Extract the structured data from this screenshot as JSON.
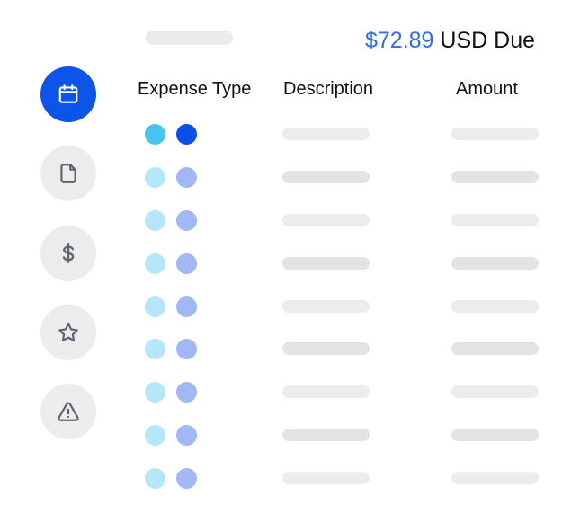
{
  "header": {
    "amount_due": "$72.89",
    "due_suffix": "USD Due"
  },
  "sidebar": {
    "items": [
      {
        "name": "calendar",
        "icon": "calendar-icon",
        "active": true
      },
      {
        "name": "document",
        "icon": "document-icon",
        "active": false
      },
      {
        "name": "dollar",
        "icon": "dollar-icon",
        "active": false
      },
      {
        "name": "star",
        "icon": "star-icon",
        "active": false
      },
      {
        "name": "warning",
        "icon": "warning-icon",
        "active": false
      }
    ]
  },
  "table": {
    "columns": [
      "Expense Type",
      "Description",
      "Amount"
    ]
  },
  "colors": {
    "accent": "#0d55e8",
    "amount_text": "#2f6ee8",
    "dot_cyan": "#46c6ee",
    "dot_blue": "#0b4fe6",
    "dot_cyan_light": "#b6e7f9",
    "dot_blue_light": "#a1b8f4",
    "placeholder_dark": "#e3e3e3",
    "placeholder_light": "#ececec"
  }
}
